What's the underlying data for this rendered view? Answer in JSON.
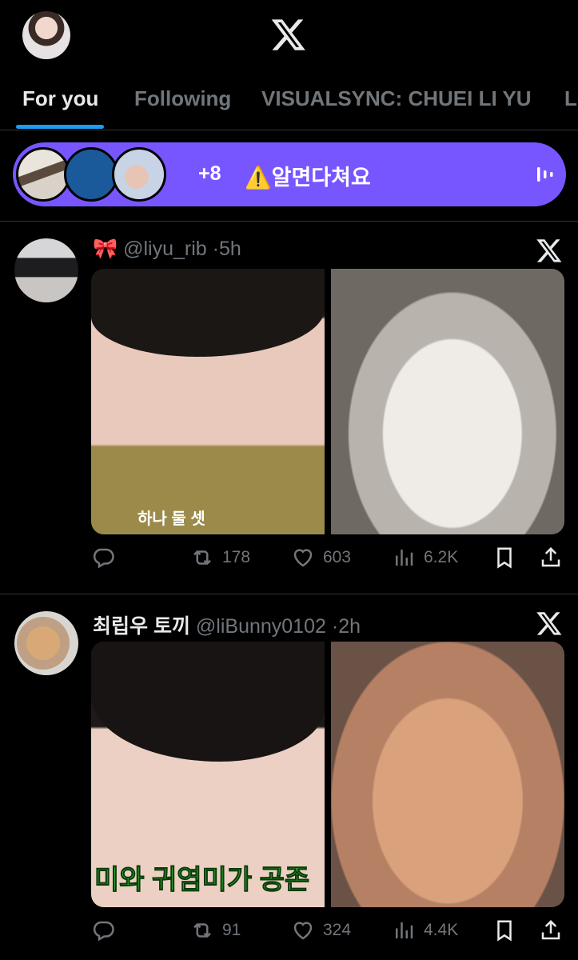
{
  "header": {
    "logo": "x-logo",
    "avatar": "profile-avatar"
  },
  "tabs": [
    {
      "label": "For you",
      "active": true
    },
    {
      "label": "Following",
      "active": false
    },
    {
      "label": "VISUALSYNC: CHUEI LI YU",
      "active": false
    },
    {
      "label": "LO",
      "active": false
    }
  ],
  "spaces": {
    "count": "+8",
    "title": "⚠️알면다쳐요",
    "icon": "audio-bars-icon",
    "accent": "#7856ff"
  },
  "posts": [
    {
      "emoji_name": "🎀",
      "handle": "@liyu_rib",
      "time": "5h",
      "media_caption": "하나 둘 셋",
      "replies": "",
      "reposts": "178",
      "likes": "603",
      "views": "6.2K"
    },
    {
      "name": "최립우 토끼",
      "handle": "@liBunny0102",
      "time": "2h",
      "media_caption": "미와 귀염미가 공존",
      "replies": "",
      "reposts": "91",
      "likes": "324",
      "views": "4.4K"
    }
  ],
  "colors": {
    "background": "#000000",
    "accent_blue": "#1d9bf0",
    "muted": "#71767b",
    "text": "#e7e9ea"
  }
}
